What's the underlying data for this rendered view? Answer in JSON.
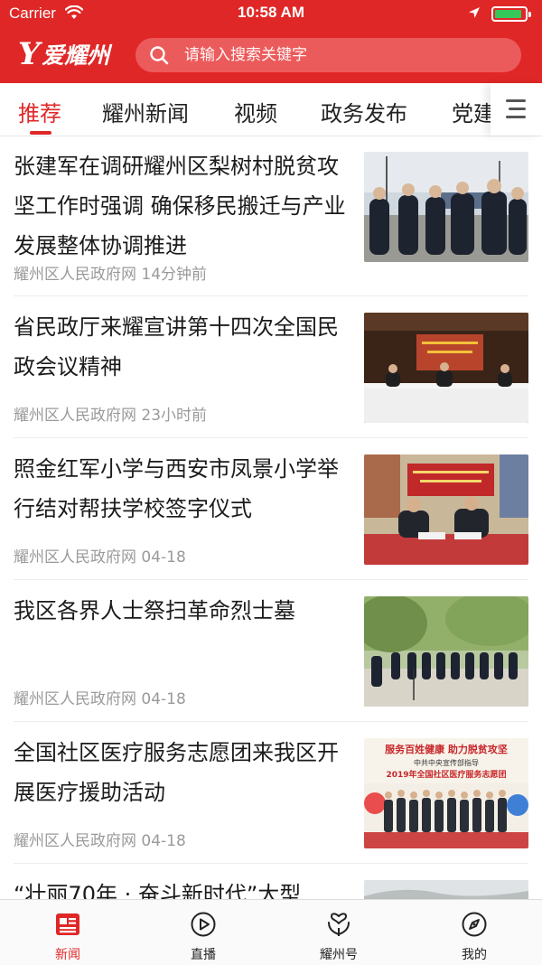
{
  "status_bar": {
    "carrier": "Carrier",
    "time": "10:58 AM",
    "battery_level": 0.92
  },
  "header": {
    "logo_mark": "Y",
    "logo_text": "爱耀州",
    "search_placeholder": "请输入搜索关键字",
    "accent_color": "#e02727"
  },
  "tabs": [
    {
      "label": "推荐",
      "active": true
    },
    {
      "label": "耀州新闻",
      "active": false
    },
    {
      "label": "视频",
      "active": false
    },
    {
      "label": "政务发布",
      "active": false
    },
    {
      "label": "党建",
      "active": false
    }
  ],
  "news": [
    {
      "title": "张建军在调研耀州区梨树村脱贫攻坚工作时强调 确保移民搬迁与产业发展整体协调推进",
      "source": "耀州区人民政府网",
      "time": "14分钟前",
      "image": "officials-inspection-photo"
    },
    {
      "title": "省民政厅来耀宣讲第十四次全国民政会议精神",
      "source": "耀州区人民政府网",
      "time": "23小时前",
      "image": "meeting-hall-photo"
    },
    {
      "title": "照金红军小学与西安市凤景小学举行结对帮扶学校签字仪式",
      "source": "耀州区人民政府网",
      "time": "04-18",
      "image": "signing-ceremony-photo"
    },
    {
      "title": "我区各界人士祭扫革命烈士墓",
      "source": "耀州区人民政府网",
      "time": "04-18",
      "image": "memorial-ceremony-photo"
    },
    {
      "title": "全国社区医疗服务志愿团来我区开展医疗援助活动",
      "source": "耀州区人民政府网",
      "time": "04-18",
      "image": "medical-volunteers-photo",
      "image_text_1": "服务百姓健康 助力脱贫攻坚",
      "image_text_2": "中共中央宣传部指导",
      "image_text_3": "2019年全国社区医疗服务志愿团"
    },
    {
      "title": "“壮丽70年 · 奋斗新时代”大型",
      "image": "landscape-photo"
    }
  ],
  "bottom_nav": [
    {
      "label": "新闻",
      "icon": "news-icon",
      "active": true
    },
    {
      "label": "直播",
      "icon": "play-icon",
      "active": false
    },
    {
      "label": "耀州号",
      "icon": "hands-heart-icon",
      "active": false
    },
    {
      "label": "我的",
      "icon": "compass-icon",
      "active": false
    }
  ]
}
